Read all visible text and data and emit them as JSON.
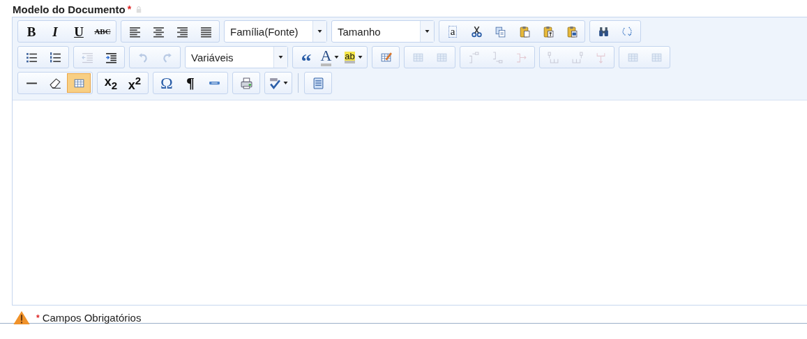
{
  "field": {
    "label": "Modelo do Documento",
    "required_mark": "*",
    "locked": true
  },
  "toolbar": [
    [
      {
        "items": [
          {
            "kind": "button",
            "glyph": "B",
            "disabled": false,
            "selected": false,
            "dropdown": false
          },
          {
            "kind": "button",
            "glyph": "I",
            "disabled": false,
            "selected": false,
            "dropdown": false
          },
          {
            "kind": "button",
            "glyph": "U",
            "disabled": false,
            "selected": false,
            "dropdown": false
          },
          {
            "kind": "button",
            "glyph": "ABC",
            "disabled": false,
            "selected": false,
            "dropdown": false
          }
        ]
      },
      {
        "items": [
          {
            "kind": "button",
            "disabled": false,
            "selected": false,
            "dropdown": false
          },
          {
            "kind": "button",
            "disabled": false,
            "selected": false,
            "dropdown": false
          },
          {
            "kind": "button",
            "disabled": false,
            "selected": false,
            "dropdown": false
          },
          {
            "kind": "button",
            "disabled": false,
            "selected": false,
            "dropdown": false
          }
        ]
      },
      {
        "items": [
          {
            "kind": "select",
            "value": "Família(Fonte)"
          }
        ]
      },
      {
        "items": [
          {
            "kind": "select",
            "value": "Tamanho"
          }
        ]
      },
      {
        "items": [
          {
            "kind": "button",
            "glyph": "a",
            "disabled": false,
            "selected": false,
            "dropdown": false
          },
          {
            "kind": "button",
            "disabled": false,
            "selected": false,
            "dropdown": false
          },
          {
            "kind": "button",
            "disabled": false,
            "selected": false,
            "dropdown": false
          },
          {
            "kind": "button",
            "disabled": false,
            "selected": false,
            "dropdown": false
          },
          {
            "kind": "button",
            "disabled": false,
            "selected": false,
            "dropdown": false
          },
          {
            "kind": "button",
            "disabled": false,
            "selected": false,
            "dropdown": false
          }
        ]
      },
      {
        "items": [
          {
            "kind": "button",
            "disabled": false,
            "selected": false,
            "dropdown": false
          },
          {
            "kind": "button",
            "disabled": false,
            "selected": false,
            "dropdown": false
          }
        ]
      }
    ],
    [
      {
        "items": [
          {
            "kind": "button",
            "disabled": false,
            "selected": false,
            "dropdown": false
          },
          {
            "kind": "button",
            "disabled": false,
            "selected": false,
            "dropdown": false
          }
        ]
      },
      {
        "items": [
          {
            "kind": "button",
            "disabled": true,
            "selected": false,
            "dropdown": false
          },
          {
            "kind": "button",
            "disabled": false,
            "selected": false,
            "dropdown": false
          }
        ]
      },
      {
        "items": [
          {
            "kind": "button",
            "disabled": true,
            "selected": false,
            "dropdown": false
          },
          {
            "kind": "button",
            "disabled": true,
            "selected": false,
            "dropdown": false
          }
        ]
      },
      {
        "items": [
          {
            "kind": "select",
            "value": "Variáveis"
          }
        ]
      },
      {
        "items": [
          {
            "kind": "button",
            "glyph": "“",
            "disabled": false,
            "selected": false,
            "dropdown": false
          },
          {
            "kind": "button",
            "glyph": "A",
            "disabled": false,
            "selected": false,
            "dropdown": true
          },
          {
            "kind": "button",
            "glyph": "ab",
            "disabled": false,
            "selected": false,
            "dropdown": true
          }
        ]
      },
      {
        "items": [
          {
            "kind": "button",
            "disabled": false,
            "selected": false,
            "dropdown": false
          }
        ]
      },
      {
        "items": [
          {
            "kind": "button",
            "disabled": true,
            "selected": false,
            "dropdown": false
          },
          {
            "kind": "button",
            "disabled": true,
            "selected": false,
            "dropdown": false
          }
        ]
      },
      {
        "items": [
          {
            "kind": "button",
            "disabled": true,
            "selected": false,
            "dropdown": false
          },
          {
            "kind": "button",
            "disabled": true,
            "selected": false,
            "dropdown": false
          },
          {
            "kind": "button",
            "disabled": true,
            "selected": false,
            "dropdown": false
          }
        ]
      },
      {
        "items": [
          {
            "kind": "button",
            "disabled": true,
            "selected": false,
            "dropdown": false
          },
          {
            "kind": "button",
            "disabled": true,
            "selected": false,
            "dropdown": false
          },
          {
            "kind": "button",
            "disabled": true,
            "selected": false,
            "dropdown": false
          }
        ]
      },
      {
        "items": [
          {
            "kind": "button",
            "disabled": true,
            "selected": false,
            "dropdown": false
          },
          {
            "kind": "button",
            "disabled": true,
            "selected": false,
            "dropdown": false
          }
        ]
      }
    ],
    [
      {
        "items": [
          {
            "kind": "button",
            "disabled": false,
            "selected": false,
            "dropdown": false
          },
          {
            "kind": "button",
            "disabled": false,
            "selected": false,
            "dropdown": false
          },
          {
            "kind": "button",
            "disabled": false,
            "selected": true,
            "dropdown": false
          }
        ]
      },
      {
        "items": [
          {
            "kind": "button",
            "glyph": "x$_{2}$",
            "disabled": false,
            "selected": false,
            "dropdown": false
          },
          {
            "kind": "button",
            "glyph": "x$^{2}$",
            "disabled": false,
            "selected": false,
            "dropdown": false
          }
        ]
      },
      {
        "items": [
          {
            "kind": "button",
            "glyph": "Ω",
            "disabled": false,
            "selected": false,
            "dropdown": false
          },
          {
            "kind": "button",
            "glyph": "¶",
            "disabled": false,
            "selected": false,
            "dropdown": false
          },
          {
            "kind": "button",
            "disabled": false,
            "selected": false,
            "dropdown": false
          }
        ]
      },
      {
        "items": [
          {
            "kind": "button",
            "disabled": false,
            "selected": false,
            "dropdown": false
          }
        ]
      },
      {
        "items": [
          {
            "kind": "button",
            "disabled": false,
            "selected": false,
            "dropdown": true
          }
        ]
      },
      {
        "items": [
          {
            "kind": "button",
            "disabled": false,
            "selected": false,
            "dropdown": false
          }
        ]
      }
    ]
  ],
  "footer": {
    "mark": "*",
    "text": "Campos Obrigatórios"
  }
}
